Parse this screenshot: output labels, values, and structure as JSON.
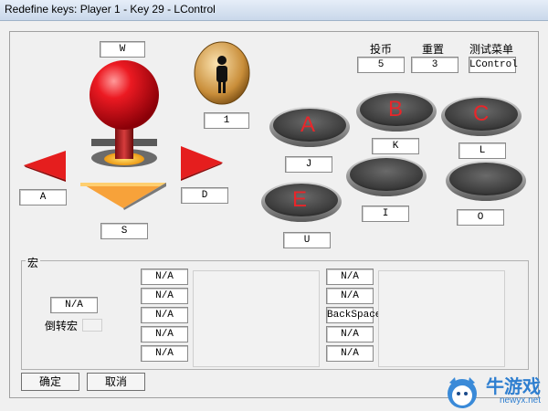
{
  "window": {
    "title": "Redefine keys: Player 1 - Key 29 - LControl"
  },
  "joystick": {
    "up_key": "W",
    "down_key": "S",
    "left_key": "A",
    "right_key": "D"
  },
  "player_button": {
    "key": "1"
  },
  "top_right": {
    "coin": {
      "label": "投币",
      "value": "5"
    },
    "reset": {
      "label": "重置",
      "value": "3"
    },
    "test_menu": {
      "label": "测试菜单",
      "value": "LControl"
    }
  },
  "buttons": [
    {
      "letter": "A",
      "key": "J"
    },
    {
      "letter": "B",
      "key": "K"
    },
    {
      "letter": "C",
      "key": "L"
    },
    {
      "letter": "",
      "key": "I"
    },
    {
      "letter": "",
      "key": "O"
    },
    {
      "letter": "E",
      "key": "U"
    }
  ],
  "macro": {
    "group_label": "宏",
    "main_value": "N/A",
    "reverse_label": "倒转宏",
    "left_keys": [
      "N/A",
      "N/A",
      "N/A",
      "N/A",
      "N/A"
    ],
    "right_keys": [
      "N/A",
      "N/A",
      "BackSpace",
      "N/A",
      "N/A"
    ]
  },
  "dialog": {
    "ok_label": "确定",
    "cancel_label": "取消"
  },
  "watermark": {
    "text": "牛游戏",
    "domain": "newyx.net"
  },
  "colors": {
    "red_button_letter": "#e8262a",
    "ball": "#e0101a",
    "arrow": "#e51e1e",
    "base": "#f28a1e"
  }
}
